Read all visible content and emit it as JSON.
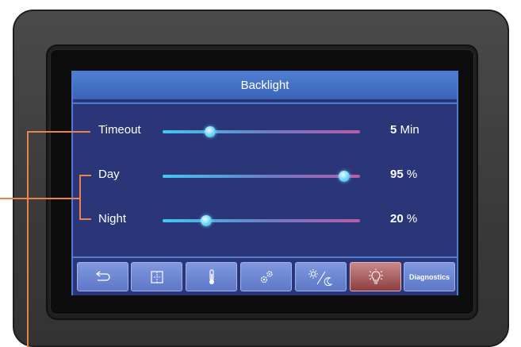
{
  "screen": {
    "title": "Backlight"
  },
  "settings": {
    "timeout": {
      "label": "Timeout",
      "value": "5",
      "unit": "Min",
      "level": 0.24
    },
    "day": {
      "label": "Day",
      "value": "95",
      "unit": "%",
      "level": 0.92
    },
    "night": {
      "label": "Night",
      "value": "20",
      "unit": "%",
      "level": 0.22
    }
  },
  "nav": {
    "buttons": [
      {
        "icon": "back-icon"
      },
      {
        "icon": "screen-layout-icon"
      },
      {
        "icon": "thermometer-icon"
      },
      {
        "icon": "settings-gears-icon"
      },
      {
        "icon": "day-night-icon"
      },
      {
        "icon": "backlight-bulb-icon",
        "active": true
      },
      {
        "label": "Diagnostics"
      }
    ]
  },
  "colors": {
    "accent": "#4f7ed0",
    "background": "#2a3678",
    "active_button": "#8f3e40",
    "callout": "#e9834a"
  }
}
